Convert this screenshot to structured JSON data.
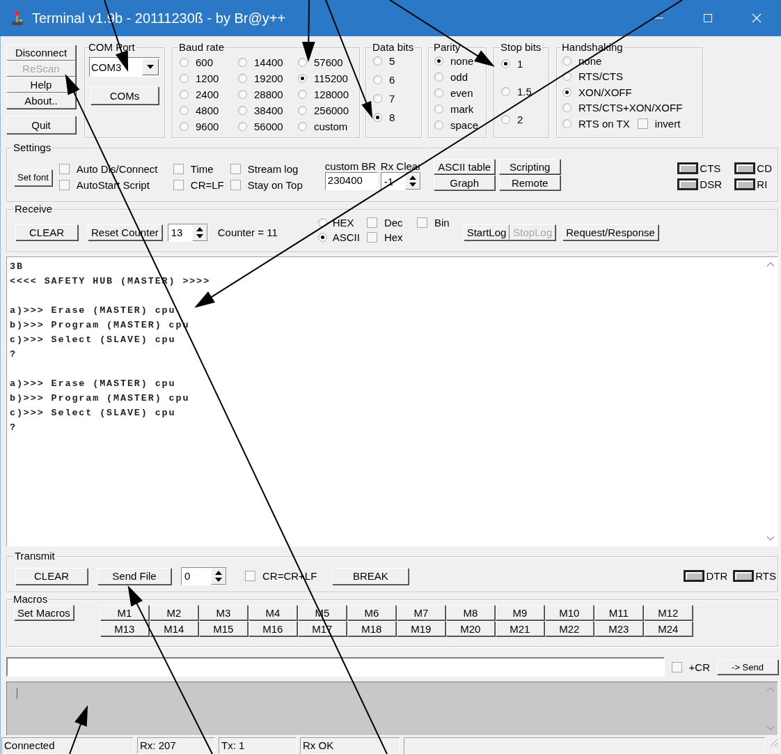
{
  "window": {
    "title": "Terminal v1.9b - 20111230ß - by Br@y++"
  },
  "left_buttons": [
    {
      "label": "Disconnect",
      "disabled": false
    },
    {
      "label": "ReScan",
      "disabled": true
    },
    {
      "label": "Help",
      "disabled": false
    },
    {
      "label": "About..",
      "disabled": false
    },
    {
      "label": "Quit",
      "disabled": false
    }
  ],
  "com_port": {
    "title": "COM Port",
    "value": "COM3",
    "button": "COMs"
  },
  "baud_rate": {
    "title": "Baud rate",
    "options": [
      {
        "label": "600",
        "selected": false
      },
      {
        "label": "1200",
        "selected": false
      },
      {
        "label": "2400",
        "selected": false
      },
      {
        "label": "4800",
        "selected": false
      },
      {
        "label": "9600",
        "selected": false
      },
      {
        "label": "14400",
        "selected": false
      },
      {
        "label": "19200",
        "selected": false
      },
      {
        "label": "28800",
        "selected": false
      },
      {
        "label": "38400",
        "selected": false
      },
      {
        "label": "56000",
        "selected": false
      },
      {
        "label": "57600",
        "selected": false
      },
      {
        "label": "115200",
        "selected": true
      },
      {
        "label": "128000",
        "selected": false
      },
      {
        "label": "256000",
        "selected": false
      },
      {
        "label": "custom",
        "selected": false
      }
    ]
  },
  "data_bits": {
    "title": "Data bits",
    "options": [
      {
        "label": "5",
        "selected": false
      },
      {
        "label": "6",
        "selected": false
      },
      {
        "label": "7",
        "selected": false
      },
      {
        "label": "8",
        "selected": true
      }
    ]
  },
  "parity": {
    "title": "Parity",
    "options": [
      {
        "label": "none",
        "selected": true
      },
      {
        "label": "odd",
        "selected": false
      },
      {
        "label": "even",
        "selected": false
      },
      {
        "label": "mark",
        "selected": false
      },
      {
        "label": "space",
        "selected": false
      }
    ]
  },
  "stop_bits": {
    "title": "Stop bits",
    "options": [
      {
        "label": "1",
        "selected": true
      },
      {
        "label": "1.5",
        "selected": false
      },
      {
        "label": "2",
        "selected": false
      }
    ]
  },
  "handshaking": {
    "title": "Handshaking",
    "options": [
      {
        "label": "none",
        "selected": false
      },
      {
        "label": "RTS/CTS",
        "selected": false
      },
      {
        "label": "XON/XOFF",
        "selected": true
      },
      {
        "label": "RTS/CTS+XON/XOFF",
        "selected": false
      },
      {
        "label": "RTS on TX",
        "selected": false
      }
    ],
    "invert": {
      "label": "invert",
      "checked": false
    }
  },
  "settings": {
    "title": "Settings",
    "set_font": "Set font",
    "checkboxes": [
      {
        "label": "Auto Dis/Connect",
        "checked": false
      },
      {
        "label": "AutoStart Script",
        "checked": false
      },
      {
        "label": "Time",
        "checked": false
      },
      {
        "label": "CR=LF",
        "checked": false
      },
      {
        "label": "Stream log",
        "checked": false
      },
      {
        "label": "Stay on Top",
        "checked": false
      }
    ],
    "custom_br": {
      "label": "custom BR",
      "value": "230400"
    },
    "rx_clear": {
      "label": "Rx Clear",
      "value": "-1"
    },
    "buttons": [
      "ASCII table",
      "Scripting",
      "Graph",
      "Remote"
    ],
    "indicators": [
      "CTS",
      "CD",
      "DSR",
      "RI"
    ]
  },
  "receive": {
    "title": "Receive",
    "clear": "CLEAR",
    "reset_counter": "Reset Counter",
    "counter_spin": "13",
    "counter_text": "Counter =  11",
    "format": [
      {
        "label": "HEX",
        "selected": false
      },
      {
        "label": "ASCII",
        "selected": true
      }
    ],
    "display": [
      {
        "label": "Dec",
        "checked": false
      },
      {
        "label": "Bin",
        "checked": false
      },
      {
        "label": "Hex",
        "checked": false
      }
    ],
    "log_buttons": [
      {
        "label": "StartLog",
        "disabled": false
      },
      {
        "label": "StopLog",
        "disabled": true
      }
    ],
    "request_response": "Request/Response"
  },
  "receive_log": {
    "text": "3B\n<<<< SAFETY HUB (MASTER) >>>>\n\na)>>> Erase (MASTER) cpu\nb)>>> Program (MASTER) cpu\nc)>>> Select (SLAVE) cpu\n?\n\na)>>> Erase (MASTER) cpu\nb)>>> Program (MASTER) cpu\nc)>>> Select (SLAVE) cpu\n?"
  },
  "transmit": {
    "title": "Transmit",
    "clear": "CLEAR",
    "send_file": "Send File",
    "spin": "0",
    "cr_crlf": {
      "label": "CR=CR+LF",
      "checked": false
    },
    "break": "BREAK",
    "indicators": [
      "DTR",
      "RTS"
    ]
  },
  "macros": {
    "title": "Macros",
    "set_macros": "Set Macros",
    "buttons": [
      "M1",
      "M2",
      "M3",
      "M4",
      "M5",
      "M6",
      "M7",
      "M8",
      "M9",
      "M10",
      "M11",
      "M12",
      "M13",
      "M14",
      "M15",
      "M16",
      "M17",
      "M18",
      "M19",
      "M20",
      "M21",
      "M22",
      "M23",
      "M24"
    ]
  },
  "send_line": {
    "cr": {
      "label": "+CR",
      "checked": false
    },
    "send": "-> Send"
  },
  "status_bar": [
    "Connected",
    "Rx: 207",
    "Tx: 1",
    "Rx OK"
  ]
}
